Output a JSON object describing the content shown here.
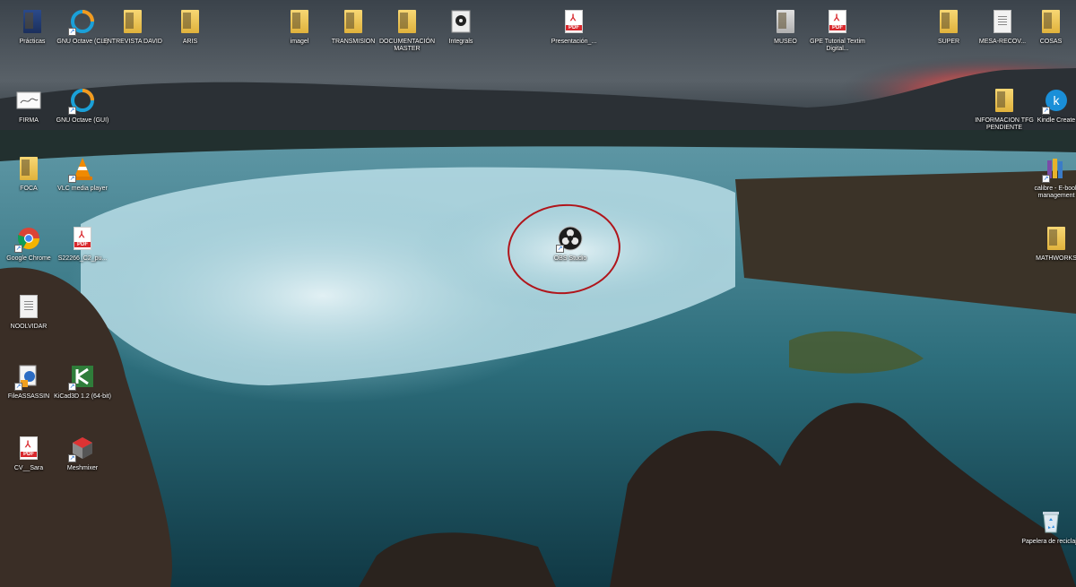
{
  "desktop": {
    "icons": [
      {
        "label": "Prácticas",
        "type": "folder"
      },
      {
        "label": "GNU Octave (CLI)",
        "type": "octave"
      },
      {
        "label": "ENTREVISTA DAVID",
        "type": "folder"
      },
      {
        "label": "ARIS",
        "type": "folder"
      },
      {
        "label": "imagel",
        "type": "folder"
      },
      {
        "label": "TRANSMISION",
        "type": "folder"
      },
      {
        "label": "DOCUMENTACIÓN MASTER",
        "type": "folder"
      },
      {
        "label": "Integrals",
        "type": "app"
      },
      {
        "label": "Presentación_...",
        "type": "pdf"
      },
      {
        "label": "MUSEO",
        "type": "folder"
      },
      {
        "label": "GPE Tutorial Textim Digital...",
        "type": "pdf"
      },
      {
        "label": "SUPER",
        "type": "folder"
      },
      {
        "label": "MESA-RECOV...",
        "type": "doc"
      },
      {
        "label": "COSAS",
        "type": "folder"
      },
      {
        "label": "FIRMA",
        "type": "image"
      },
      {
        "label": "GNU Octave (GUI)",
        "type": "octave"
      },
      {
        "label": "INFORMACION TFG PENDIENTE",
        "type": "folder"
      },
      {
        "label": "Kindle Create",
        "type": "kindle"
      },
      {
        "label": "FOCA",
        "type": "folder"
      },
      {
        "label": "VLC media player",
        "type": "vlc"
      },
      {
        "label": "calibre - E-book management",
        "type": "calibre"
      },
      {
        "label": "Google Chrome",
        "type": "chrome"
      },
      {
        "label": "S22266_C2_pu...",
        "type": "pdf"
      },
      {
        "label": "OBS Studio",
        "type": "obs"
      },
      {
        "label": "MATHWORKS",
        "type": "folder"
      },
      {
        "label": "NOOLVIDAR",
        "type": "doc"
      },
      {
        "label": "FileASSASSIN",
        "type": "fileassassin"
      },
      {
        "label": "KiCad3D 1.2 (64-bit)",
        "type": "kicad"
      },
      {
        "label": "CV__Sara",
        "type": "pdf"
      },
      {
        "label": "Meshmixer",
        "type": "meshmixer"
      },
      {
        "label": "Papelera de reciclaje",
        "type": "recycle"
      }
    ]
  },
  "colors": {
    "sky_top": "#3d4650",
    "sunset": "#e25a4a",
    "water": "#2d6c7a",
    "annotation": "#b0151b"
  }
}
